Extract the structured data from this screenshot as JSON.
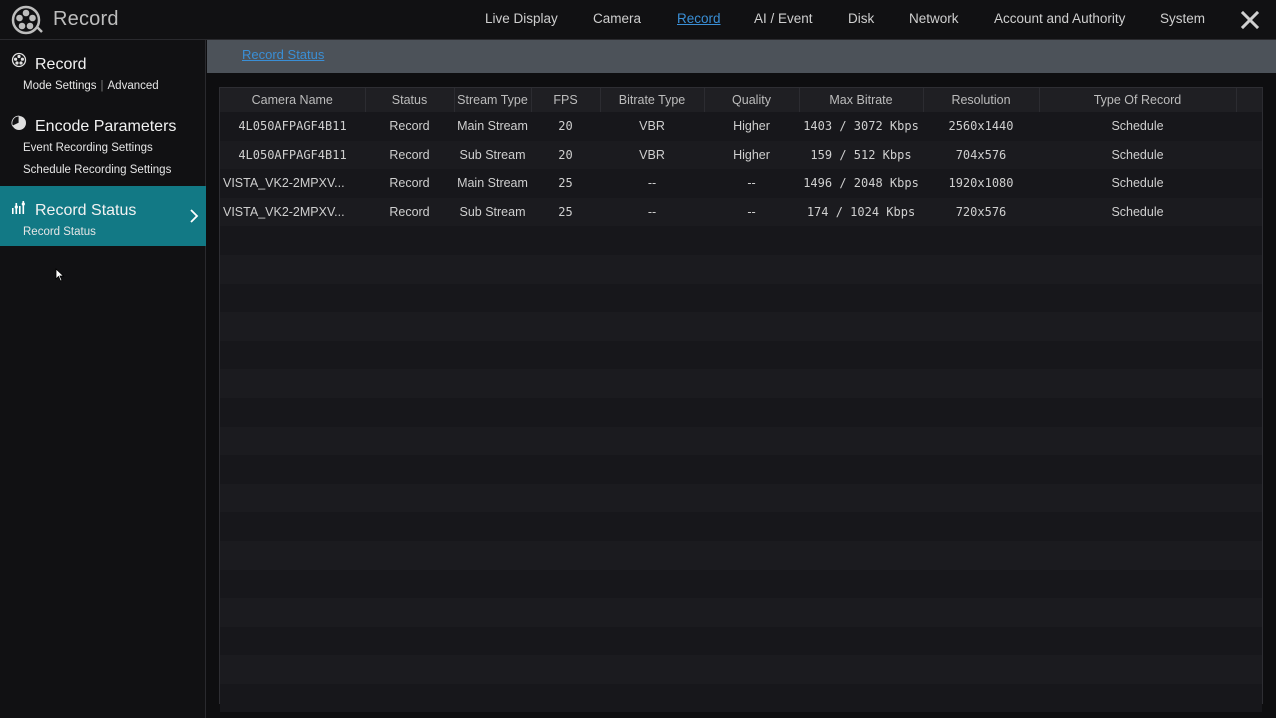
{
  "app": {
    "title": "Record",
    "logo_icon": "film-reel-icon"
  },
  "nav": {
    "items": [
      {
        "label": "Live Display",
        "active": false
      },
      {
        "label": "Camera",
        "active": false
      },
      {
        "label": "Record",
        "active": true
      },
      {
        "label": "AI / Event",
        "active": false
      },
      {
        "label": "Disk",
        "active": false
      },
      {
        "label": "Network",
        "active": false
      },
      {
        "label": "Account and Authority",
        "active": false
      },
      {
        "label": "System",
        "active": false
      }
    ],
    "close_icon": "close-icon"
  },
  "sidebar": {
    "groups": [
      {
        "title": "Record",
        "icon": "film-reel-icon",
        "subs": [
          "Mode Settings",
          "Advanced"
        ]
      },
      {
        "title": "Encode Parameters",
        "icon": "pie-chart-icon",
        "subs": [
          "Event Recording Settings",
          "Schedule Recording Settings"
        ]
      },
      {
        "title": "Record Status",
        "icon": "bar-stats-icon",
        "subs": [
          "Record Status"
        ],
        "active": true
      }
    ]
  },
  "subheader": {
    "tab": "Record Status"
  },
  "table": {
    "columns": [
      "Camera Name",
      "Status",
      "Stream Type",
      "FPS",
      "Bitrate Type",
      "Quality",
      "Max Bitrate",
      "Resolution",
      "Type Of Record"
    ],
    "rows": [
      [
        "4L050AFPAGF4B11",
        "Record",
        "Main Stream",
        "20",
        "VBR",
        "Higher",
        "1403 / 3072 Kbps",
        "2560x1440",
        "Schedule"
      ],
      [
        "4L050AFPAGF4B11",
        "Record",
        "Sub Stream",
        "20",
        "VBR",
        "Higher",
        "159 / 512 Kbps",
        "704x576",
        "Schedule"
      ],
      [
        "VISTA_VK2-2MPXV...",
        "Record",
        "Main Stream",
        "25",
        "--",
        "--",
        "1496 / 2048 Kbps",
        "1920x1080",
        "Schedule"
      ],
      [
        "VISTA_VK2-2MPXV...",
        "Record",
        "Sub Stream",
        "25",
        "--",
        "--",
        "174 / 1024 Kbps",
        "720x576",
        "Schedule"
      ]
    ]
  },
  "colors": {
    "accent": "#127985",
    "link": "#3a8fd6",
    "background": "#0e0e10"
  }
}
